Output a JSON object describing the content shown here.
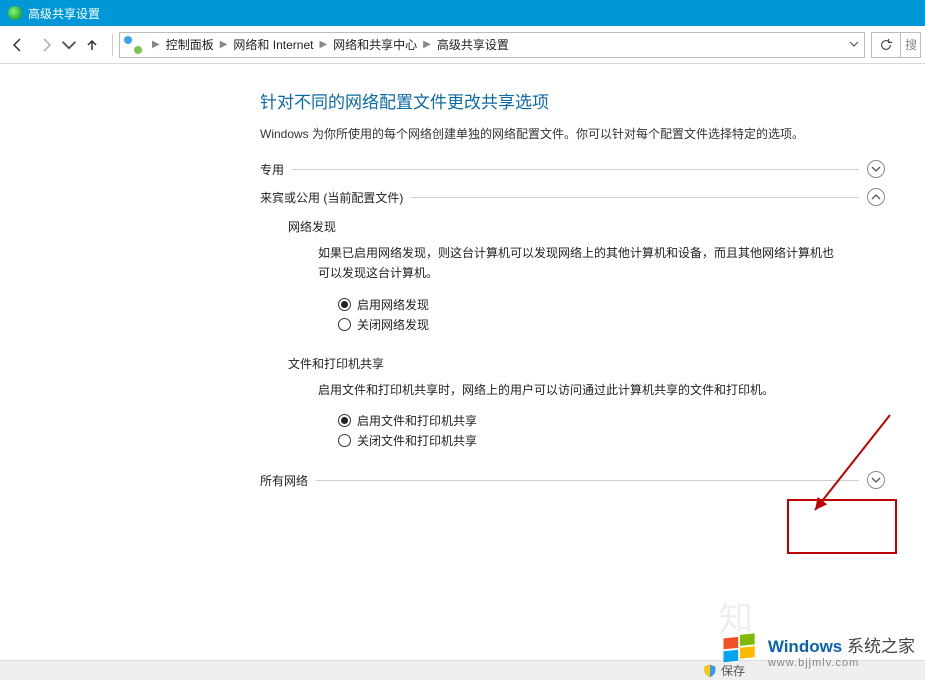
{
  "window": {
    "title": "高级共享设置"
  },
  "nav": {
    "crumbs": [
      "控制面板",
      "网络和 Internet",
      "网络和共享中心",
      "高级共享设置"
    ],
    "search_placeholder": "搜"
  },
  "page": {
    "title": "针对不同的网络配置文件更改共享选项",
    "description": "Windows 为你所使用的每个网络创建单独的网络配置文件。你可以针对每个配置文件选择特定的选项。"
  },
  "sections": {
    "private": {
      "label": "专用"
    },
    "guest": {
      "label": "来宾或公用 (当前配置文件)",
      "network_discovery": {
        "title": "网络发现",
        "desc": "如果已启用网络发现，则这台计算机可以发现网络上的其他计算机和设备，而且其他网络计算机也可以发现这台计算机。",
        "opt_on": "启用网络发现",
        "opt_off": "关闭网络发现"
      },
      "file_print": {
        "title": "文件和打印机共享",
        "desc": "启用文件和打印机共享时，网络上的用户可以访问通过此计算机共享的文件和打印机。",
        "opt_on": "启用文件和打印机共享",
        "opt_off": "关闭文件和打印机共享"
      }
    },
    "all": {
      "label": "所有网络"
    }
  },
  "footer": {
    "save": "保存"
  },
  "watermark": {
    "brand": "Windows",
    "brand_cn": "系统之家",
    "url": "www.bjjmlv.com"
  }
}
